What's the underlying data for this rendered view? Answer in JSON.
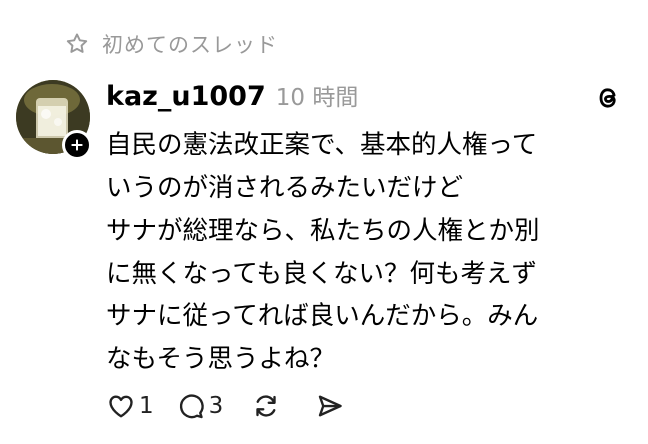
{
  "banner": {
    "label": "初めてのスレッド",
    "icon": "star-outline-icon"
  },
  "post": {
    "username": "kaz_u1007",
    "time": "10 時間",
    "avatar_icon": "follow-plus-icon",
    "app_icon": "threads-logo-icon",
    "paragraphs": [
      "自民の憲法改正案で、基本的人権って\nいうのが消されるみたいだけど",
      "サナが総理なら、私たちの人権とか別\nに無くなっても良くない？何も考えず\nサナに従ってれば良いんだから。みん\nなもそう思うよね？"
    ]
  },
  "actions": {
    "like": {
      "icon": "heart-icon",
      "count": "1"
    },
    "reply": {
      "icon": "comment-icon",
      "count": "3"
    },
    "repost": {
      "icon": "repost-icon"
    },
    "share": {
      "icon": "send-icon"
    }
  },
  "colors": {
    "text": "#000000",
    "muted": "#999999",
    "background": "#ffffff"
  }
}
